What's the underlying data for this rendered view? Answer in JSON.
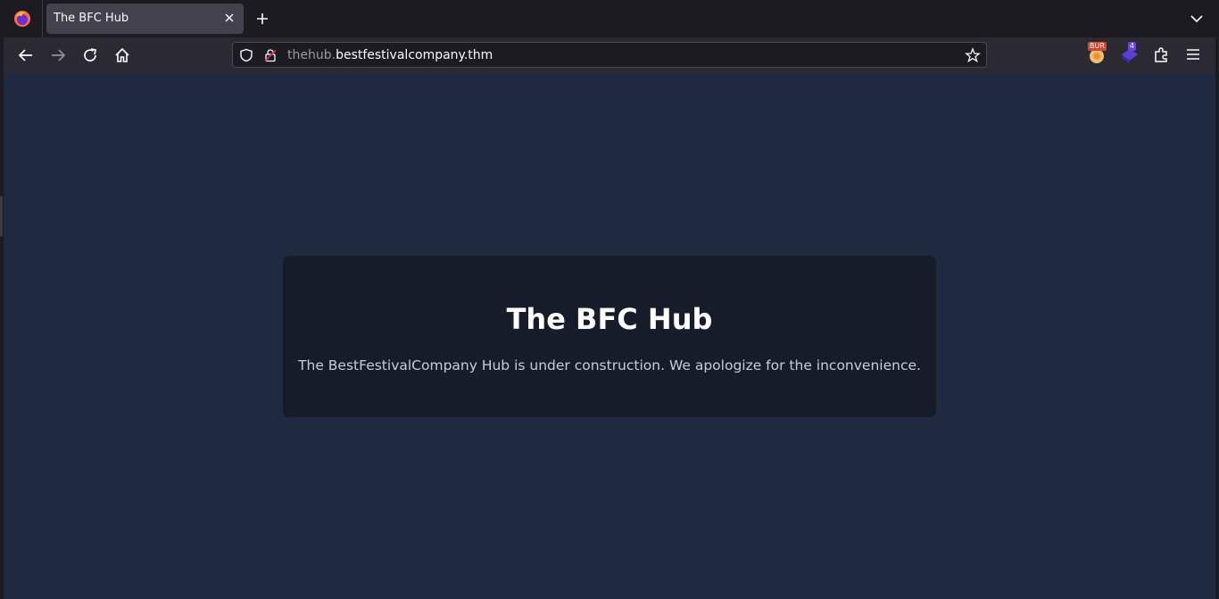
{
  "browser": {
    "tab": {
      "title": "The BFC Hub"
    },
    "url": {
      "prefix": "thehub.",
      "domain": "bestfestivalcompany.thm"
    },
    "extensions": [
      {
        "name": "burp-extension-icon",
        "badge": "BUR"
      },
      {
        "name": "foxyproxy-extension-icon",
        "badge": "4"
      }
    ]
  },
  "page": {
    "title": "The BFC Hub",
    "message": "The BestFestivalCompany Hub is under construction. We apologize for the inconvenience."
  },
  "colors": {
    "page_background": "#1f2a40",
    "card_background": "#171c2b",
    "browser_chrome": "#2b2a33"
  }
}
